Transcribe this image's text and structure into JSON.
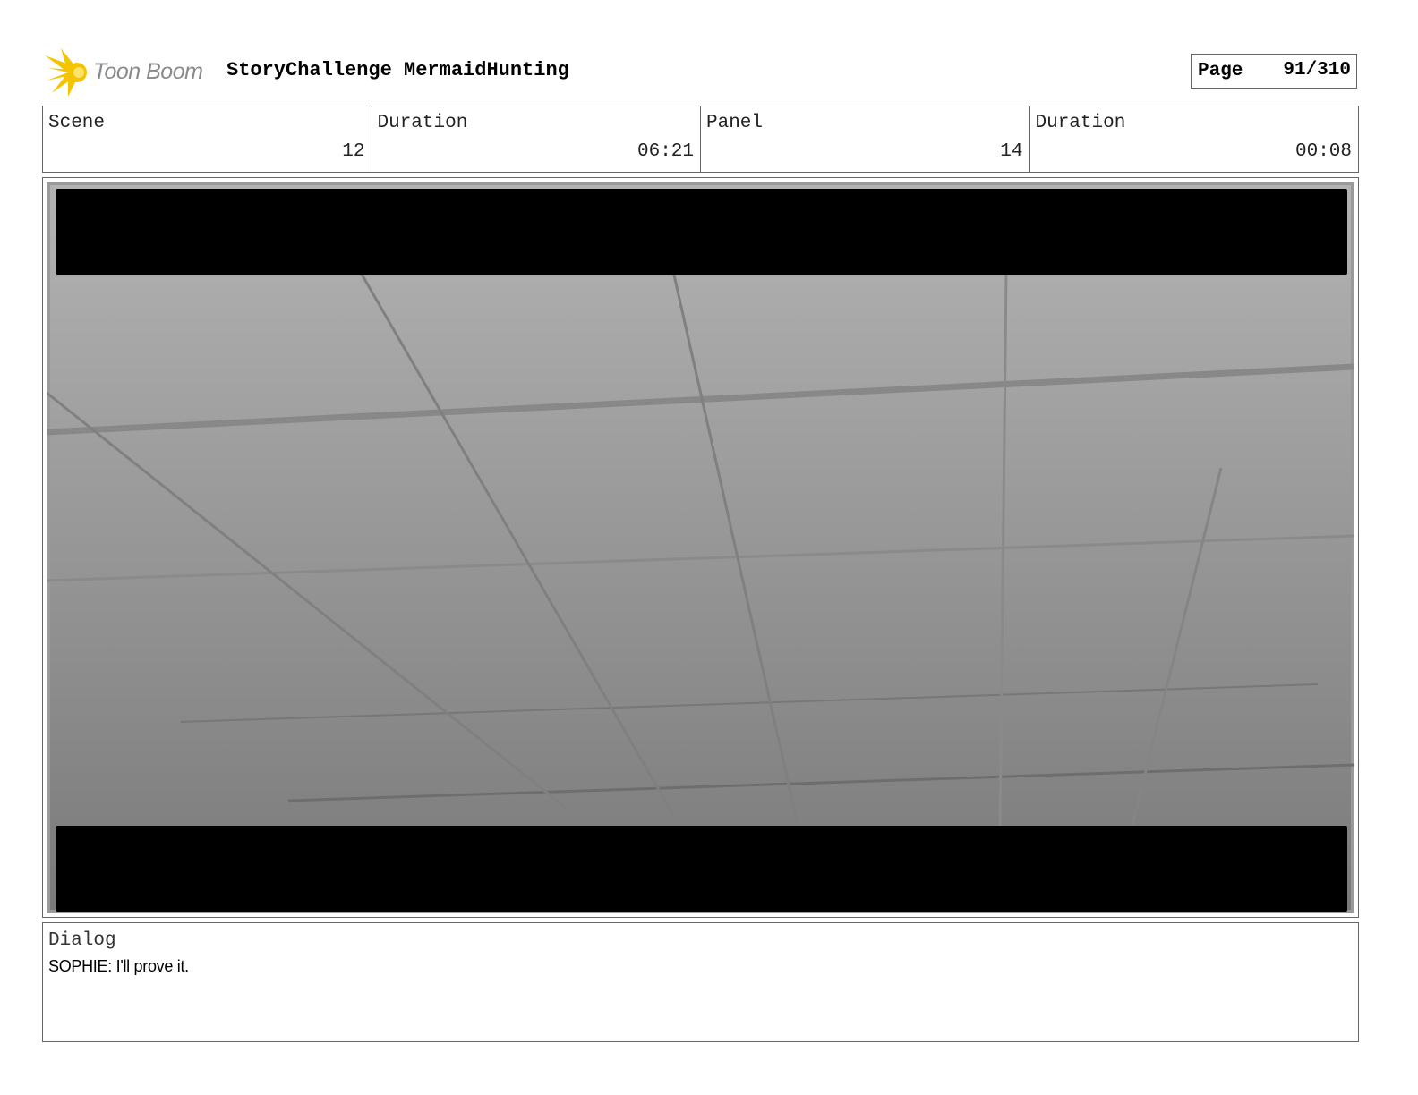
{
  "header": {
    "logo_text": "Toon Boom",
    "project_title": "StoryChallenge MermaidHunting",
    "page_label": "Page",
    "page_value": "91/310"
  },
  "info": {
    "scene_label": "Scene",
    "scene_value": "12",
    "scene_duration_label": "Duration",
    "scene_duration_value": "06:21",
    "panel_label": "Panel",
    "panel_value": "14",
    "panel_duration_label": "Duration",
    "panel_duration_value": "00:08"
  },
  "dialog": {
    "label": "Dialog",
    "text": "SOPHIE: I'll prove it."
  },
  "colors": {
    "logo_yellow": "#f5c400",
    "letterbox": "#000000",
    "ceiling_top": "#b3b3b3",
    "ceiling_bottom": "#7a7a7a"
  }
}
